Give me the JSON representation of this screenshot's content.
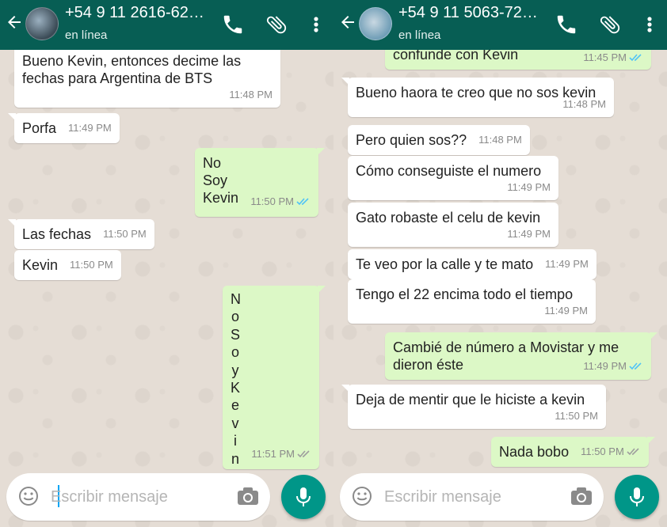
{
  "colors": {
    "header": "#075e54",
    "outgoing": "#dcf8c6",
    "incoming": "#ffffff",
    "mic": "#009688",
    "tick_blue": "#4fc3f7"
  },
  "left_chat": {
    "contact_number": "+54 9 11 2616-62…",
    "status": "en línea",
    "messages": [
      {
        "text": "Bueno Kevin, entonces decime las fechas para Argentina de BTS",
        "time": "11:48 PM"
      },
      {
        "text": "Porfa",
        "time": "11:49 PM"
      },
      {
        "text": "No\nSoy\nKevin",
        "time": "11:50 PM"
      },
      {
        "text": "Las fechas",
        "time": "11:50 PM"
      },
      {
        "text": "Kevin",
        "time": "11:50 PM"
      },
      {
        "letters": [
          "N",
          "o",
          "S",
          "o",
          "y",
          "K",
          "e",
          "v",
          "i",
          "n"
        ],
        "time": "11:51 PM"
      }
    ],
    "input_placeholder": "Escribir mensaje"
  },
  "right_chat": {
    "contact_number": "+54 9 11 5063-72…",
    "status": "en línea",
    "messages": [
      {
        "text": "confunde con Kevin",
        "time": "11:45 PM"
      },
      {
        "text": "Bueno haora te creo que no sos kevin",
        "time": "11:48 PM"
      },
      {
        "text": "Pero quien sos??",
        "time": "11:48 PM"
      },
      {
        "text": "Cómo conseguiste el numero",
        "time": "11:49 PM"
      },
      {
        "text": "Gato robaste el celu de kevin",
        "time": "11:49 PM"
      },
      {
        "text": "Te veo por la calle y te mato",
        "time": "11:49 PM"
      },
      {
        "text": "Tengo el 22 encima todo el tiempo",
        "time": "11:49 PM"
      },
      {
        "text": "Cambié de número a Movistar y me dieron éste",
        "time": "11:49 PM"
      },
      {
        "text": "Deja de mentir que le hiciste a kevin",
        "time": "11:50 PM"
      },
      {
        "text": "Nada bobo",
        "time": "11:50 PM"
      }
    ],
    "input_placeholder": "Escribir mensaje"
  }
}
